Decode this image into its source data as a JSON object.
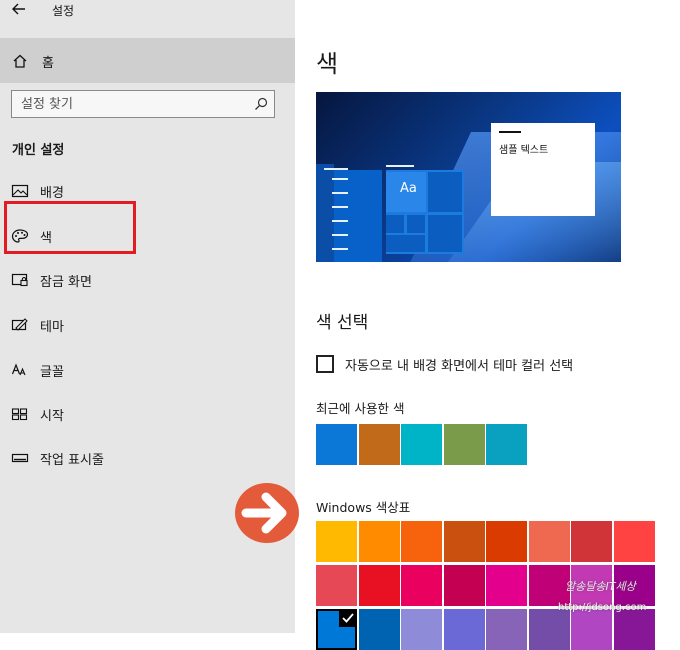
{
  "app": {
    "title": "설정"
  },
  "sidebar": {
    "home_label": "홈",
    "search_placeholder": "설정 찾기",
    "section_title": "개인 설정",
    "items": [
      {
        "label": "배경",
        "icon": "picture-icon"
      },
      {
        "label": "색",
        "icon": "palette-icon"
      },
      {
        "label": "잠금 화면",
        "icon": "lock-screen-icon"
      },
      {
        "label": "테마",
        "icon": "theme-icon"
      },
      {
        "label": "글꼴",
        "icon": "font-icon"
      },
      {
        "label": "시작",
        "icon": "start-icon"
      },
      {
        "label": "작업 표시줄",
        "icon": "taskbar-icon"
      }
    ],
    "highlighted_item": "색",
    "highlight_color": "#e31c23"
  },
  "main": {
    "page_title": "색",
    "preview": {
      "sample_text": "샘플 텍스트",
      "tile_text": "Aa"
    },
    "choose_title": "색 선택",
    "auto_color_label": "자동으로 내 배경 화면에서 테마 컬러 선택",
    "auto_color_checked": false,
    "recent_title": "최근에 사용한 색",
    "recent_colors": [
      "#0b78d7",
      "#c06a1a",
      "#00b4c8",
      "#7a9c4a",
      "#0aa0c0"
    ],
    "palette_title": "Windows 색상표",
    "palette": [
      [
        "#ffb900",
        "#ff8c00",
        "#f7630c",
        "#ca5010",
        "#da3b01",
        "#ef6950",
        "#d13438",
        "#ff4343"
      ],
      [
        "#e74856",
        "#e81123",
        "#ea005e",
        "#c30052",
        "#e3008c",
        "#bf0077",
        "#c239b3",
        "#9a0089"
      ],
      [
        "#0078d7",
        "#0063b1",
        "#8e8cd8",
        "#6b69d6",
        "#8764b8",
        "#744da9",
        "#b146c2",
        "#881798"
      ]
    ],
    "selected_palette_color": "#0078d7"
  },
  "overlay": {
    "arrow_color": "#e35b3a",
    "watermark_text": "알송달송IT세상",
    "watermark_url": "http://jdsong.com"
  }
}
